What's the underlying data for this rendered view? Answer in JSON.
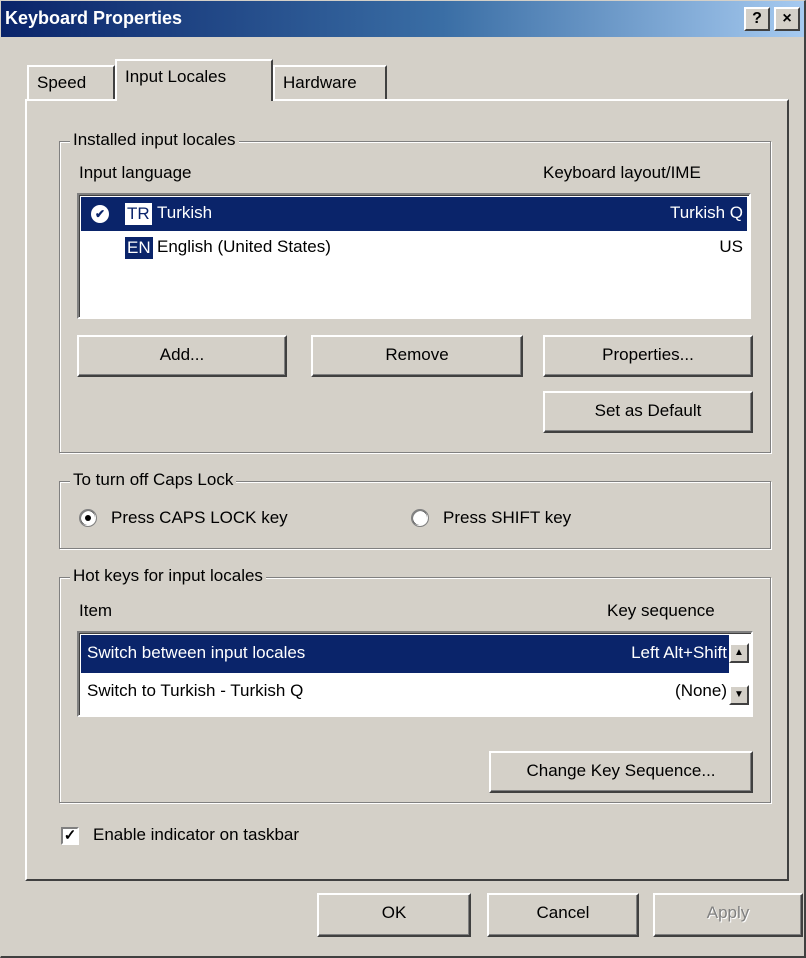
{
  "window": {
    "title": "Keyboard Properties",
    "help_glyph": "?",
    "close_glyph": "×"
  },
  "tabs": [
    {
      "label": "Speed",
      "active": false
    },
    {
      "label": "Input Locales",
      "active": true
    },
    {
      "label": "Hardware",
      "active": false
    }
  ],
  "installed": {
    "group_title": "Installed input locales",
    "col_language": "Input language",
    "col_layout": "Keyboard layout/IME",
    "rows": [
      {
        "code": "TR",
        "name": "Turkish",
        "layout": "Turkish Q",
        "selected": true,
        "default": true
      },
      {
        "code": "EN",
        "name": "English (United States)",
        "layout": "US",
        "selected": false,
        "default": false
      }
    ],
    "buttons": {
      "add": "Add...",
      "remove": "Remove",
      "properties": "Properties...",
      "set_default": "Set as Default"
    }
  },
  "capslock": {
    "group_title": "To turn off Caps Lock",
    "option_caps": "Press CAPS LOCK key",
    "option_shift": "Press SHIFT key",
    "selected": "caps"
  },
  "hotkeys": {
    "group_title": "Hot keys for input locales",
    "col_item": "Item",
    "col_sequence": "Key sequence",
    "rows": [
      {
        "item": "Switch between input locales",
        "sequence": "Left Alt+Shift",
        "selected": true
      },
      {
        "item": "Switch to Turkish - Turkish Q",
        "sequence": "(None)",
        "selected": false
      }
    ],
    "change_button": "Change Key Sequence..."
  },
  "indicator": {
    "label": "Enable indicator on taskbar",
    "checked": true
  },
  "footer": {
    "ok": "OK",
    "cancel": "Cancel",
    "apply": "Apply"
  },
  "colors": {
    "selection": "#0a246a",
    "face": "#d4d0c8"
  }
}
